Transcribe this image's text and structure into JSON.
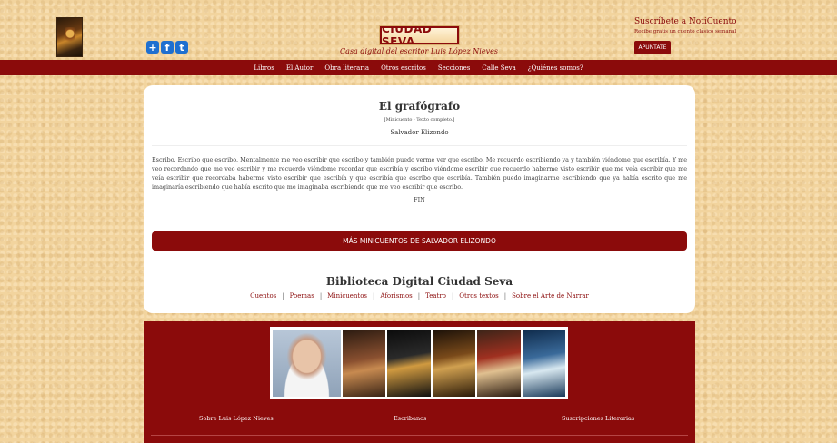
{
  "header": {
    "logo_text": "CIUDAD SEVA",
    "tagline": "Casa digital del escritor Luis López Nieves",
    "share_icons": [
      "share-icon",
      "facebook-icon",
      "twitter-icon"
    ],
    "subscribe": {
      "title": "Suscríbete a NotiCuento",
      "subtitle": "Recibe gratis un cuento clásico semanal",
      "button": "APÚNTATE"
    }
  },
  "nav": {
    "items": [
      "Libros",
      "El Autor",
      "Obra literaria",
      "Otros escritos",
      "Secciones",
      "Calle Seva",
      "¿Quiénes somos?"
    ]
  },
  "story": {
    "title": "El grafógrafo",
    "meta": "[Minicuento - Texto completo.]",
    "author": "Salvador Elizondo",
    "body": "Escribo. Escribo que escribo. Mentalmente me veo escribir que escribo y también puedo verme ver que escribo. Me recuerdo escribiendo ya y también viéndome que escribía. Y me veo recordando que me veo escribir y me recuerdo viéndome recordar que escribía y escribo viéndome escribir que recuerdo haberme visto escribir que me veía escribir que me veía escribir que recordaba haberme visto escribir que escribía y que escribía que escribo que escribía. También puedo imaginarme escribiendo que ya había escrito que me imaginaría escribiendo que había escrito que me imaginaba escribiendo que me veo escribir que escribo.",
    "end": "FIN",
    "more_button": "MÁS MINICUENTOS DE SALVADOR ELIZONDO"
  },
  "library": {
    "title": "Biblioteca Digital Ciudad Seva",
    "links": [
      "Cuentos",
      "Poemas",
      "Minicuentos",
      "Aforismos",
      "Teatro",
      "Otros textos",
      "Sobre el Arte de Narrar"
    ]
  },
  "footer": {
    "links": [
      "Sobre Luis López Nieves",
      "Escribanos",
      "Suscripciones Literarias"
    ]
  },
  "colors": {
    "brand": "#8b0b0b",
    "background": "#f2d49e",
    "card": "#ffffff"
  }
}
